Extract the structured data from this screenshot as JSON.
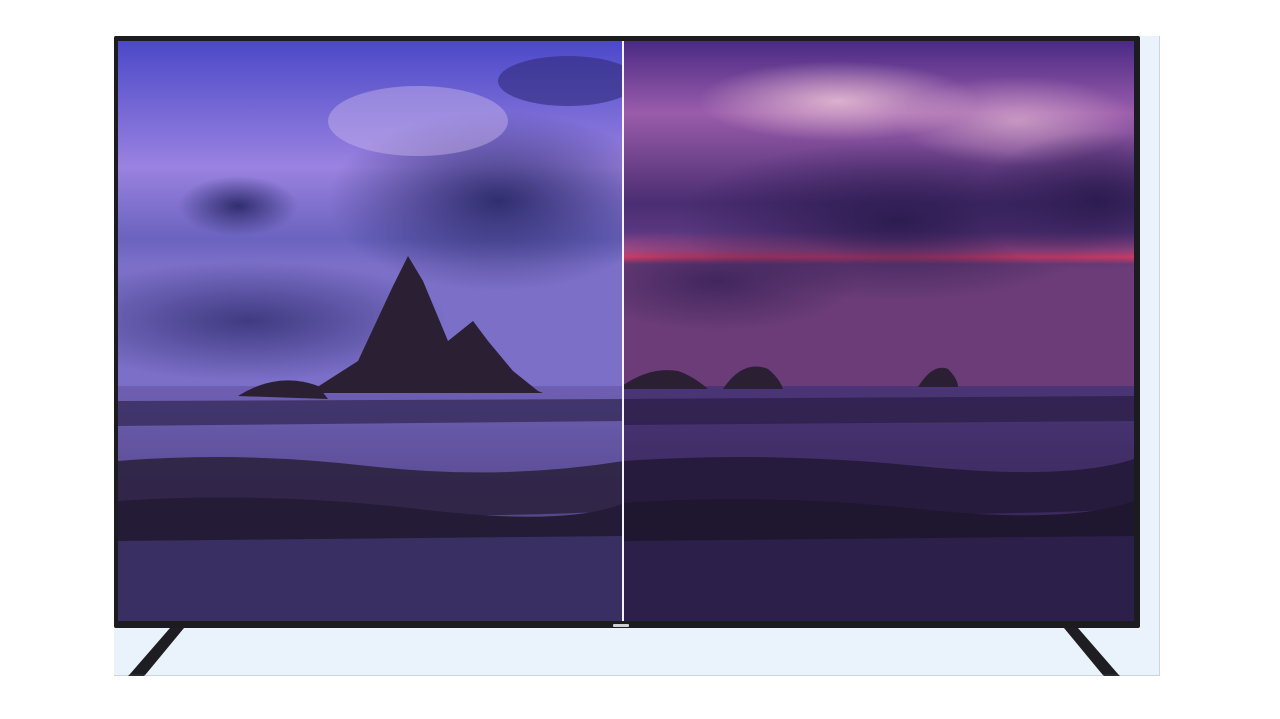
{
  "scene": {
    "subject": "tv-comparison",
    "colors": {
      "left_sky_top": "#4b49c8",
      "left_sky_mid": "#8b6fd8",
      "left_sky_low": "#6a63bf",
      "right_sky_top": "#3a1e6e",
      "right_sky_mid": "#8a4aa0",
      "horizon_glow": "#e0406a",
      "rock": "#2a1f33",
      "water_left": "#5a4a90",
      "water_right": "#3c2a5e",
      "foreground": "#2c2240",
      "divider": "#f4f2fb",
      "bezel": "#1c1c20",
      "backdrop": "#eaf3fb"
    }
  }
}
